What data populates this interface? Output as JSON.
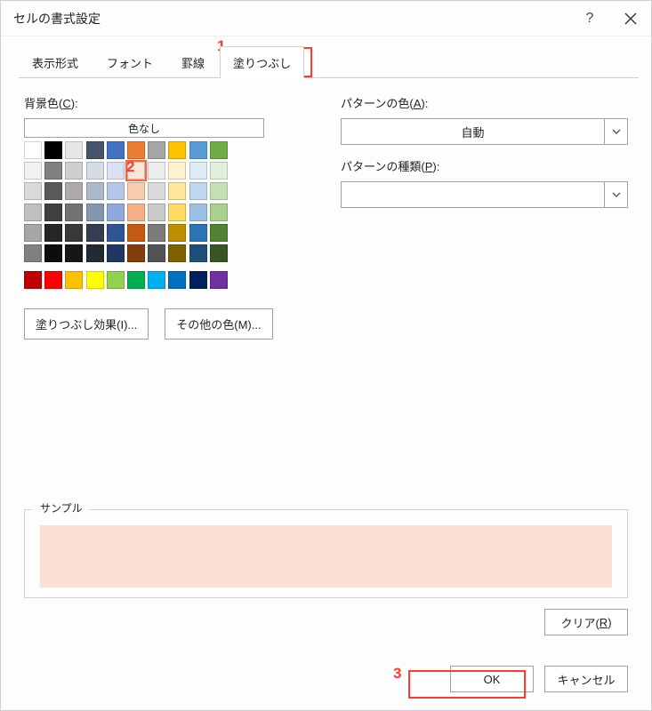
{
  "window": {
    "title": "セルの書式設定"
  },
  "tabs": {
    "items": [
      "表示形式",
      "フォント",
      "罫線",
      "塗りつぶし"
    ],
    "active_index": 3
  },
  "left": {
    "bg_label_prefix": "背景色(",
    "bg_label_accel": "C",
    "bg_label_suffix": "):",
    "no_color": "色なし",
    "fill_effects_btn": "塗りつぶし効果(I)...",
    "more_colors_btn": "その他の色(M)...",
    "palette": {
      "row0": [
        "#ffffff",
        "#000000",
        "#e7e6e6",
        "#44546a",
        "#4472c4",
        "#ed7d31",
        "#a5a5a5",
        "#ffc000",
        "#5b9bd5",
        "#70ad47"
      ],
      "row1": [
        "#f2f2f2",
        "#7f7f7f",
        "#d0cece",
        "#d6dce4",
        "#d9e1f2",
        "#fce4d6",
        "#ededed",
        "#fff2cc",
        "#ddebf7",
        "#e2efda"
      ],
      "row2": [
        "#d9d9d9",
        "#595959",
        "#aeaaaa",
        "#acb9ca",
        "#b4c6e7",
        "#f8cbad",
        "#dbdbdb",
        "#ffe699",
        "#bdd7ee",
        "#c6e0b4"
      ],
      "row3": [
        "#bfbfbf",
        "#404040",
        "#757171",
        "#8497b0",
        "#8ea9db",
        "#f4b084",
        "#c9c9c9",
        "#ffd966",
        "#9bc2e6",
        "#a9d08e"
      ],
      "row4": [
        "#a6a6a6",
        "#262626",
        "#3a3838",
        "#333f4f",
        "#305496",
        "#c65911",
        "#7b7b7b",
        "#bf8f00",
        "#2f75b5",
        "#548235"
      ],
      "row5": [
        "#808080",
        "#0d0d0d",
        "#161616",
        "#222b35",
        "#203764",
        "#833c0c",
        "#525252",
        "#806000",
        "#1f4e78",
        "#375623"
      ],
      "standard": [
        "#c00000",
        "#ff0000",
        "#ffc000",
        "#ffff00",
        "#92d050",
        "#00b050",
        "#00b0f0",
        "#0070c0",
        "#002060",
        "#7030a0"
      ]
    },
    "selected": {
      "row": 1,
      "col": 5,
      "color": "#fce4d6"
    }
  },
  "right": {
    "pattern_color_label_prefix": "パターンの色(",
    "pattern_color_label_accel": "A",
    "pattern_color_label_suffix": "):",
    "pattern_color_value": "自動",
    "pattern_type_label_prefix": "パターンの種類(",
    "pattern_type_label_accel": "P",
    "pattern_type_label_suffix": "):",
    "pattern_type_value": ""
  },
  "sample": {
    "label": "サンプル",
    "fill": "#fbe0d3"
  },
  "buttons": {
    "clear_prefix": "クリア(",
    "clear_accel": "R",
    "clear_suffix": ")",
    "ok": "OK",
    "cancel": "キャンセル"
  },
  "callouts": {
    "n1": "1",
    "n2": "2",
    "n3": "3"
  }
}
